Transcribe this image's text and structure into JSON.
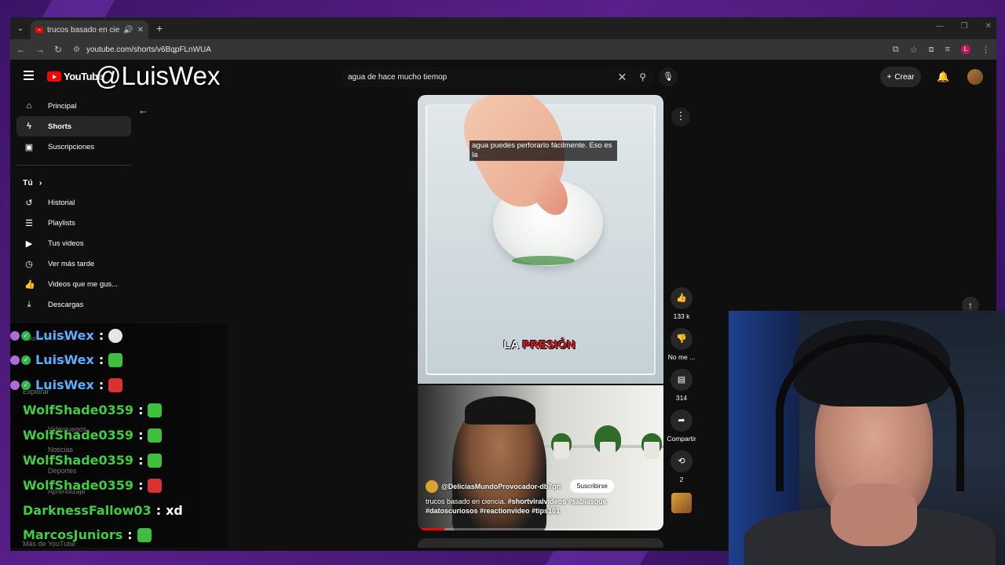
{
  "browser": {
    "tab_title": "trucos basado en ciencia. #",
    "tab_close": "✕",
    "new_tab": "+",
    "url": "youtube.com/shorts/v6BqpFLnWUA"
  },
  "overlay": {
    "watermark": "@LuisWex"
  },
  "header": {
    "logo_text": "YouTube",
    "search_value": "agua de hace mucho tiemop",
    "create_label": "Crear"
  },
  "sidebar": {
    "items": [
      {
        "label": "Principal",
        "icon": "home-icon"
      },
      {
        "label": "Shorts",
        "icon": "shorts-icon"
      },
      {
        "label": "Suscripciones",
        "icon": "subscriptions-icon"
      }
    ],
    "you_title": "Tú",
    "you_items": [
      {
        "label": "Historial",
        "icon": "history-icon"
      },
      {
        "label": "Playlists",
        "icon": "playlists-icon"
      },
      {
        "label": "Tus videos",
        "icon": "your-videos-icon"
      },
      {
        "label": "Ver más tarde",
        "icon": "watch-later-icon"
      },
      {
        "label": "Videos que me gus...",
        "icon": "liked-icon"
      },
      {
        "label": "Descargas",
        "icon": "downloads-icon"
      }
    ],
    "faint": [
      "Suscripciones",
      "Libreria",
      "Explorar",
      "Videojuegos",
      "Noticias",
      "Deportes",
      "Aprendizaje",
      "Más de YouTube"
    ]
  },
  "video": {
    "caption": "agua puedes perforarlo fácilmente. Eso es la",
    "text_overlay_white": "LA",
    "text_overlay_red": "PRESIÓN",
    "channel": "@DeliciasMundoProvocador-db7qh",
    "subscribe_label": "Suscribirse",
    "description_plain": "trucos basado en ciencia.",
    "hashtags": "#shortviralvideos #sabiasque #datoscuriosos #reactionvideo #tips101",
    "progress_percent": 11
  },
  "actions": {
    "like_count": "133 k",
    "dislike_label": "No me ...",
    "comments_count": "314",
    "share_label": "Compartir",
    "remix_count": "2"
  },
  "chat": [
    {
      "user": "LuisWex",
      "sep": ":",
      "emote": "skull",
      "color": "blue"
    },
    {
      "user": "LuisWex",
      "sep": ":",
      "emote": "green",
      "color": "blue"
    },
    {
      "user": "LuisWex",
      "sep": ":",
      "emote": "red",
      "color": "blue"
    },
    {
      "user": "WolfShade0359",
      "sep": ":",
      "emote": "green",
      "color": "green"
    },
    {
      "user": "WolfShade0359",
      "sep": ":",
      "emote": "green",
      "color": "green"
    },
    {
      "user": "WolfShade0359",
      "sep": ":",
      "emote": "green",
      "color": "green"
    },
    {
      "user": "WolfShade0359",
      "sep": ":",
      "emote": "red",
      "color": "green"
    },
    {
      "user": "DarknessFallow03",
      "sep": ":",
      "text": "xd",
      "color": "green"
    },
    {
      "user": "MarcosJuniors",
      "sep": ":",
      "emote": "green",
      "color": "green"
    }
  ],
  "colors": {
    "yt_red": "#ff0000",
    "chat_green": "#3ecf3e",
    "chat_blue": "#5ab0ff"
  }
}
